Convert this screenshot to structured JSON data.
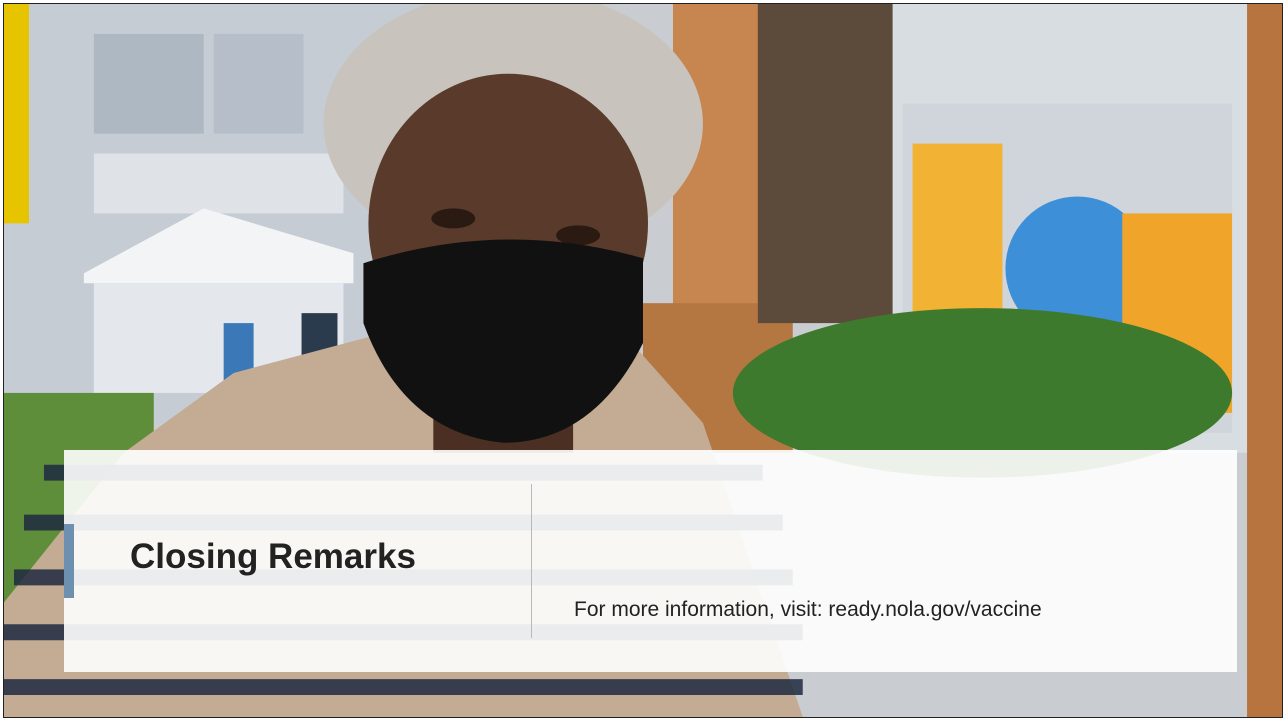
{
  "slide": {
    "title": "Closing Remarks",
    "info": "For more information, visit: ready.nola.gov/vaccine"
  },
  "colors": {
    "accent": "#6d8fb0",
    "panel": "#ffffff",
    "text": "#222222"
  }
}
